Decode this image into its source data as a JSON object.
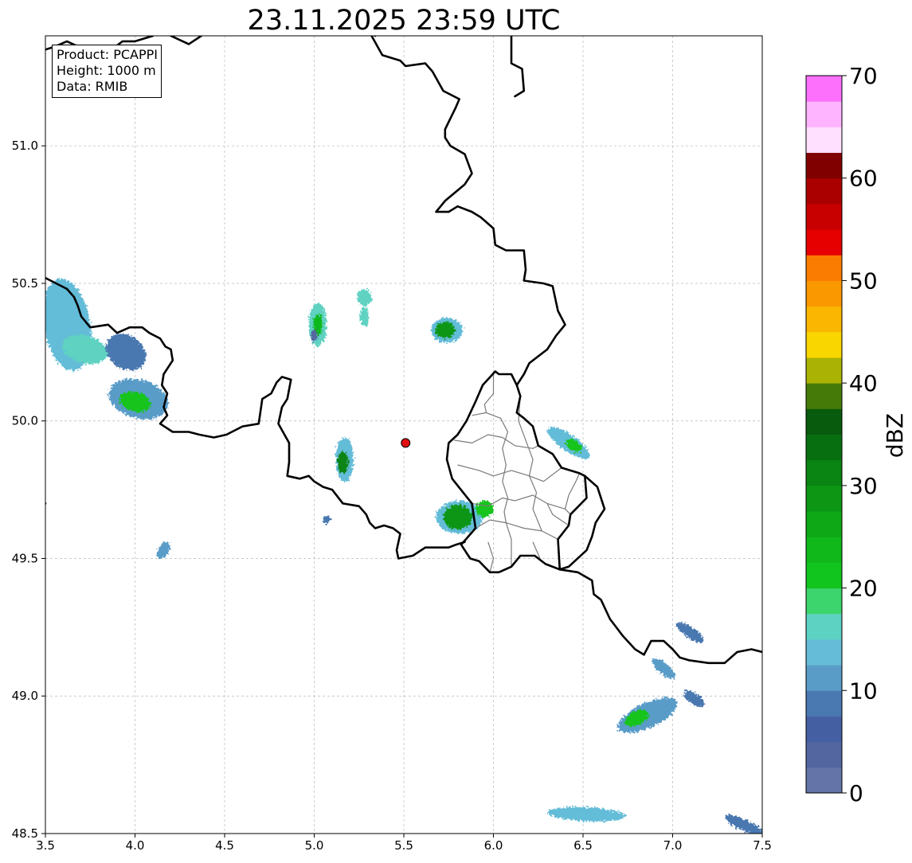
{
  "title": "23.11.2025 23:59 UTC",
  "infobox": {
    "product": "Product: PCAPPI",
    "height": "Height: 1000 m",
    "source": "Data: RMIB"
  },
  "x_axis": {
    "range": [
      3.5,
      7.5
    ],
    "ticks": [
      {
        "value": 3.5,
        "label": "3.5"
      },
      {
        "value": 4.0,
        "label": "4.0"
      },
      {
        "value": 4.5,
        "label": "4.5"
      },
      {
        "value": 5.0,
        "label": "5.0"
      },
      {
        "value": 5.5,
        "label": "5.5"
      },
      {
        "value": 6.0,
        "label": "6.0"
      },
      {
        "value": 6.5,
        "label": "6.5"
      },
      {
        "value": 7.0,
        "label": "7.0"
      },
      {
        "value": 7.5,
        "label": "7.5"
      }
    ]
  },
  "y_axis": {
    "range": [
      48.5,
      51.4
    ],
    "ticks": [
      {
        "value": 48.5,
        "label": "48.5"
      },
      {
        "value": 49.0,
        "label": "49.0"
      },
      {
        "value": 49.5,
        "label": "49.5"
      },
      {
        "value": 50.0,
        "label": "50.0"
      },
      {
        "value": 50.5,
        "label": "50.5"
      },
      {
        "value": 51.0,
        "label": "51.0"
      }
    ]
  },
  "grid": true,
  "radar_site": {
    "lon": 5.51,
    "lat": 49.92,
    "color": "#e01010"
  },
  "colorbar": {
    "label": "dBZ",
    "range": [
      0,
      70
    ],
    "step": 2.5,
    "tick_values": [
      0,
      10,
      20,
      30,
      40,
      50,
      60,
      70
    ],
    "tick_labels": [
      "0",
      "10",
      "20",
      "30",
      "40",
      "50",
      "60",
      "70"
    ],
    "colors": [
      "#6474a8",
      "#5466a0",
      "#4560a2",
      "#4a78b0",
      "#5a9cc8",
      "#64bcd8",
      "#5ed2c2",
      "#3cd46c",
      "#12c41e",
      "#10b81a",
      "#0ea816",
      "#0c9614",
      "#0a8412",
      "#086f10",
      "#085a0c",
      "#467a08",
      "#aab204",
      "#fad600",
      "#fab600",
      "#fa9800",
      "#fa7c00",
      "#e60000",
      "#c80000",
      "#aa0000",
      "#800000",
      "#ffe0ff",
      "#ffb4ff",
      "#fc70fc",
      "#ee34ee"
    ]
  },
  "echo_cells": [
    {
      "lon": 3.62,
      "lat": 50.35,
      "rx": 0.13,
      "ry": 0.17,
      "angle": 10,
      "dbz": 14
    },
    {
      "lon": 3.72,
      "lat": 50.26,
      "rx": 0.13,
      "ry": 0.05,
      "angle": -15,
      "dbz": 17
    },
    {
      "lon": 3.95,
      "lat": 50.25,
      "rx": 0.12,
      "ry": 0.06,
      "angle": -35,
      "dbz": 8
    },
    {
      "lon": 4.02,
      "lat": 50.08,
      "rx": 0.17,
      "ry": 0.07,
      "angle": -15,
      "dbz": 12
    },
    {
      "lon": 4.0,
      "lat": 50.07,
      "rx": 0.09,
      "ry": 0.035,
      "angle": -15,
      "dbz": 22
    },
    {
      "lon": 5.02,
      "lat": 50.35,
      "rx": 0.05,
      "ry": 0.08,
      "angle": 0,
      "dbz": 15
    },
    {
      "lon": 5.02,
      "lat": 50.35,
      "rx": 0.025,
      "ry": 0.04,
      "angle": 0,
      "dbz": 24
    },
    {
      "lon": 5.28,
      "lat": 50.45,
      "rx": 0.04,
      "ry": 0.03,
      "angle": 0,
      "dbz": 17
    },
    {
      "lon": 5.28,
      "lat": 50.38,
      "rx": 0.025,
      "ry": 0.035,
      "angle": 0,
      "dbz": 15
    },
    {
      "lon": 5.74,
      "lat": 50.33,
      "rx": 0.09,
      "ry": 0.045,
      "angle": 0,
      "dbz": 14
    },
    {
      "lon": 5.73,
      "lat": 50.33,
      "rx": 0.055,
      "ry": 0.03,
      "angle": 0,
      "dbz": 28
    },
    {
      "lon": 5.17,
      "lat": 49.86,
      "rx": 0.05,
      "ry": 0.08,
      "angle": 0,
      "dbz": 14
    },
    {
      "lon": 5.16,
      "lat": 49.85,
      "rx": 0.03,
      "ry": 0.04,
      "angle": 0,
      "dbz": 30
    },
    {
      "lon": 5.81,
      "lat": 49.65,
      "rx": 0.13,
      "ry": 0.06,
      "angle": 0,
      "dbz": 14
    },
    {
      "lon": 5.8,
      "lat": 49.65,
      "rx": 0.08,
      "ry": 0.045,
      "angle": 0,
      "dbz": 28
    },
    {
      "lon": 5.95,
      "lat": 49.68,
      "rx": 0.05,
      "ry": 0.03,
      "angle": 0,
      "dbz": 22
    },
    {
      "lon": 6.42,
      "lat": 49.92,
      "rx": 0.14,
      "ry": 0.03,
      "angle": -35,
      "dbz": 14
    },
    {
      "lon": 6.45,
      "lat": 49.91,
      "rx": 0.05,
      "ry": 0.02,
      "angle": -35,
      "dbz": 20
    },
    {
      "lon": 4.16,
      "lat": 49.53,
      "rx": 0.05,
      "ry": 0.02,
      "angle": 60,
      "dbz": 12
    },
    {
      "lon": 6.86,
      "lat": 48.93,
      "rx": 0.18,
      "ry": 0.045,
      "angle": 25,
      "dbz": 12
    },
    {
      "lon": 6.8,
      "lat": 48.92,
      "rx": 0.07,
      "ry": 0.025,
      "angle": 25,
      "dbz": 20
    },
    {
      "lon": 6.95,
      "lat": 49.1,
      "rx": 0.08,
      "ry": 0.02,
      "angle": -40,
      "dbz": 12
    },
    {
      "lon": 7.1,
      "lat": 49.23,
      "rx": 0.09,
      "ry": 0.02,
      "angle": -35,
      "dbz": 9
    },
    {
      "lon": 7.12,
      "lat": 48.99,
      "rx": 0.07,
      "ry": 0.02,
      "angle": -35,
      "dbz": 9
    },
    {
      "lon": 6.52,
      "lat": 48.57,
      "rx": 0.22,
      "ry": 0.025,
      "angle": -3,
      "dbz": 13
    },
    {
      "lon": 7.4,
      "lat": 48.53,
      "rx": 0.12,
      "ry": 0.02,
      "angle": -25,
      "dbz": 9
    },
    {
      "lon": 5.0,
      "lat": 50.31,
      "rx": 0.02,
      "ry": 0.02,
      "angle": 0,
      "dbz": 3
    },
    {
      "lon": 5.07,
      "lat": 49.64,
      "rx": 0.02,
      "ry": 0.015,
      "angle": 0,
      "dbz": 9
    }
  ],
  "borders": [
    [
      [
        3.5,
        50.52
      ],
      [
        3.62,
        50.48
      ],
      [
        3.66,
        50.45
      ],
      [
        3.68,
        50.42
      ],
      [
        3.7,
        50.38
      ],
      [
        3.75,
        50.34
      ],
      [
        3.85,
        50.35
      ],
      [
        3.9,
        50.32
      ],
      [
        3.97,
        50.34
      ],
      [
        4.04,
        50.34
      ],
      [
        4.08,
        50.32
      ],
      [
        4.14,
        50.3
      ],
      [
        4.17,
        50.27
      ],
      [
        4.2,
        50.26
      ],
      [
        4.21,
        50.22
      ],
      [
        4.16,
        50.17
      ],
      [
        4.15,
        50.13
      ],
      [
        4.18,
        50.1
      ],
      [
        4.16,
        50.05
      ],
      [
        4.18,
        50.02
      ],
      [
        4.14,
        49.99
      ],
      [
        4.21,
        49.96
      ],
      [
        4.3,
        49.96
      ],
      [
        4.36,
        49.95
      ],
      [
        4.44,
        49.94
      ],
      [
        4.51,
        49.95
      ],
      [
        4.6,
        49.98
      ],
      [
        4.69,
        49.99
      ],
      [
        4.71,
        50.08
      ],
      [
        4.76,
        50.1
      ],
      [
        4.79,
        50.14
      ],
      [
        4.82,
        50.16
      ],
      [
        4.87,
        50.15
      ],
      [
        4.85,
        50.08
      ],
      [
        4.82,
        50.05
      ],
      [
        4.8,
        49.99
      ],
      [
        4.86,
        49.92
      ],
      [
        4.86,
        49.85
      ],
      [
        4.85,
        49.8
      ],
      [
        4.92,
        49.79
      ],
      [
        4.97,
        49.8
      ],
      [
        5.0,
        49.78
      ],
      [
        5.05,
        49.76
      ],
      [
        5.1,
        49.75
      ],
      [
        5.16,
        49.7
      ],
      [
        5.25,
        49.69
      ],
      [
        5.29,
        49.66
      ],
      [
        5.31,
        49.63
      ],
      [
        5.34,
        49.61
      ],
      [
        5.39,
        49.62
      ],
      [
        5.44,
        49.61
      ],
      [
        5.48,
        49.59
      ],
      [
        5.46,
        49.53
      ],
      [
        5.47,
        49.5
      ],
      [
        5.55,
        49.51
      ],
      [
        5.62,
        49.54
      ],
      [
        5.7,
        49.54
      ],
      [
        5.75,
        49.54
      ],
      [
        5.79,
        49.55
      ],
      [
        5.84,
        49.56
      ]
    ],
    [
      [
        5.82,
        49.55
      ],
      [
        5.9,
        49.61
      ],
      [
        5.88,
        49.7
      ],
      [
        5.77,
        49.79
      ],
      [
        5.74,
        49.86
      ],
      [
        5.75,
        49.92
      ],
      [
        5.8,
        49.95
      ],
      [
        5.85,
        50.0
      ],
      [
        5.9,
        50.07
      ],
      [
        5.94,
        50.13
      ],
      [
        6.01,
        50.18
      ],
      [
        6.03,
        50.17
      ],
      [
        6.1,
        50.17
      ],
      [
        6.13,
        50.13
      ],
      [
        6.15,
        50.09
      ],
      [
        6.13,
        50.03
      ],
      [
        6.17,
        50.01
      ],
      [
        6.22,
        49.98
      ],
      [
        6.25,
        49.91
      ],
      [
        6.33,
        49.88
      ],
      [
        6.38,
        49.83
      ],
      [
        6.48,
        49.81
      ],
      [
        6.51,
        49.8
      ],
      [
        6.52,
        49.72
      ],
      [
        6.43,
        49.66
      ],
      [
        6.42,
        49.62
      ],
      [
        6.36,
        49.57
      ],
      [
        6.37,
        49.46
      ],
      [
        6.29,
        49.48
      ],
      [
        6.23,
        49.51
      ],
      [
        6.15,
        49.51
      ],
      [
        6.1,
        49.47
      ],
      [
        6.03,
        49.45
      ],
      [
        5.98,
        49.45
      ],
      [
        5.92,
        49.49
      ],
      [
        5.87,
        49.5
      ],
      [
        5.82,
        49.55
      ]
    ],
    [
      [
        5.32,
        51.4
      ],
      [
        5.38,
        51.33
      ],
      [
        5.48,
        51.31
      ],
      [
        5.51,
        51.29
      ],
      [
        5.62,
        51.3
      ],
      [
        5.66,
        51.27
      ],
      [
        5.72,
        51.2
      ],
      [
        5.81,
        51.17
      ],
      [
        5.79,
        51.14
      ],
      [
        5.76,
        51.1
      ],
      [
        5.73,
        51.06
      ],
      [
        5.73,
        51.03
      ],
      [
        5.76,
        51.0
      ],
      [
        5.84,
        50.97
      ],
      [
        5.88,
        50.9
      ],
      [
        5.84,
        50.86
      ],
      [
        5.73,
        50.8
      ],
      [
        5.68,
        50.76
      ],
      [
        5.75,
        50.76
      ],
      [
        5.8,
        50.78
      ],
      [
        5.88,
        50.76
      ],
      [
        5.93,
        50.74
      ],
      [
        6.0,
        50.7
      ],
      [
        6.01,
        50.64
      ],
      [
        6.07,
        50.62
      ],
      [
        6.17,
        50.62
      ],
      [
        6.18,
        50.55
      ],
      [
        6.17,
        50.51
      ],
      [
        6.28,
        50.5
      ],
      [
        6.33,
        50.49
      ],
      [
        6.36,
        50.4
      ],
      [
        6.4,
        50.35
      ],
      [
        6.35,
        50.31
      ],
      [
        6.3,
        50.26
      ],
      [
        6.2,
        50.21
      ],
      [
        6.17,
        50.17
      ],
      [
        6.13,
        50.13
      ]
    ],
    [
      [
        6.51,
        49.8
      ],
      [
        6.58,
        49.76
      ],
      [
        6.62,
        49.68
      ],
      [
        6.57,
        49.63
      ],
      [
        6.55,
        49.58
      ],
      [
        6.52,
        49.53
      ],
      [
        6.42,
        49.47
      ],
      [
        6.37,
        49.46
      ]
    ],
    [
      [
        6.37,
        49.46
      ],
      [
        6.47,
        49.45
      ],
      [
        6.55,
        49.42
      ],
      [
        6.56,
        49.37
      ],
      [
        6.6,
        49.35
      ],
      [
        6.65,
        49.28
      ],
      [
        6.72,
        49.22
      ],
      [
        6.79,
        49.17
      ],
      [
        6.84,
        49.15
      ],
      [
        6.88,
        49.2
      ],
      [
        6.95,
        49.2
      ],
      [
        7.0,
        49.17
      ],
      [
        7.04,
        49.14
      ],
      [
        7.09,
        49.13
      ],
      [
        7.2,
        49.12
      ],
      [
        7.29,
        49.12
      ],
      [
        7.36,
        49.16
      ],
      [
        7.44,
        49.17
      ],
      [
        7.5,
        49.16
      ]
    ],
    [
      [
        3.5,
        49.7
      ],
      [
        3.5,
        49.7
      ]
    ],
    [
      [
        5.34,
        51.4
      ],
      [
        5.36,
        51.45
      ]
    ],
    [
      [
        3.5,
        51.35
      ],
      [
        3.55,
        51.36
      ],
      [
        3.62,
        51.38
      ],
      [
        3.72,
        51.35
      ],
      [
        3.8,
        51.36
      ],
      [
        3.85,
        51.34
      ],
      [
        3.93,
        51.38
      ],
      [
        4.0,
        51.38
      ],
      [
        4.1,
        51.4
      ]
    ],
    [
      [
        4.2,
        51.4
      ],
      [
        4.3,
        51.37
      ],
      [
        4.37,
        51.4
      ]
    ],
    [
      [
        6.1,
        51.4
      ],
      [
        6.1,
        51.3
      ],
      [
        6.16,
        51.28
      ],
      [
        6.17,
        51.2
      ],
      [
        6.12,
        51.18
      ]
    ]
  ],
  "lux_cantons": [
    [
      [
        5.9,
        49.61
      ],
      [
        5.98,
        49.64
      ],
      [
        6.07,
        49.63
      ],
      [
        6.17,
        49.61
      ],
      [
        6.27,
        49.6
      ],
      [
        6.36,
        49.57
      ]
    ],
    [
      [
        5.88,
        49.7
      ],
      [
        5.97,
        49.69
      ],
      [
        6.05,
        49.72
      ],
      [
        6.12,
        49.71
      ],
      [
        6.22,
        49.73
      ],
      [
        6.3,
        49.7
      ],
      [
        6.4,
        49.68
      ],
      [
        6.43,
        49.66
      ]
    ],
    [
      [
        5.8,
        49.84
      ],
      [
        5.92,
        49.82
      ],
      [
        6.0,
        49.8
      ],
      [
        6.1,
        49.82
      ],
      [
        6.2,
        49.8
      ],
      [
        6.28,
        49.78
      ],
      [
        6.38,
        49.83
      ]
    ],
    [
      [
        5.78,
        49.93
      ],
      [
        5.88,
        49.92
      ],
      [
        5.97,
        49.95
      ],
      [
        6.05,
        49.94
      ],
      [
        6.12,
        49.91
      ],
      [
        6.22,
        49.9
      ],
      [
        6.25,
        49.91
      ]
    ],
    [
      [
        5.88,
        50.02
      ],
      [
        5.96,
        50.03
      ],
      [
        6.04,
        50.01
      ],
      [
        6.08,
        49.96
      ],
      [
        6.05,
        49.9
      ],
      [
        6.07,
        49.84
      ],
      [
        6.05,
        49.78
      ],
      [
        6.08,
        49.72
      ],
      [
        6.06,
        49.67
      ],
      [
        6.07,
        49.63
      ],
      [
        6.1,
        49.57
      ],
      [
        6.1,
        49.47
      ]
    ],
    [
      [
        6.15,
        50.09
      ],
      [
        6.14,
        50.0
      ],
      [
        6.18,
        49.93
      ],
      [
        6.22,
        49.86
      ],
      [
        6.2,
        49.8
      ],
      [
        6.24,
        49.74
      ],
      [
        6.22,
        49.68
      ],
      [
        6.27,
        49.6
      ]
    ],
    [
      [
        6.0,
        50.18
      ],
      [
        6.0,
        50.1
      ],
      [
        5.95,
        50.06
      ],
      [
        5.96,
        50.03
      ]
    ],
    [
      [
        6.22,
        49.56
      ],
      [
        6.26,
        49.5
      ],
      [
        6.23,
        49.51
      ]
    ],
    [
      [
        5.97,
        49.56
      ],
      [
        6.0,
        49.5
      ],
      [
        5.98,
        49.45
      ]
    ],
    [
      [
        6.4,
        49.68
      ],
      [
        6.42,
        49.73
      ],
      [
        6.46,
        49.78
      ],
      [
        6.48,
        49.81
      ]
    ],
    [
      [
        6.3,
        49.7
      ],
      [
        6.33,
        49.66
      ],
      [
        6.42,
        49.62
      ]
    ]
  ]
}
